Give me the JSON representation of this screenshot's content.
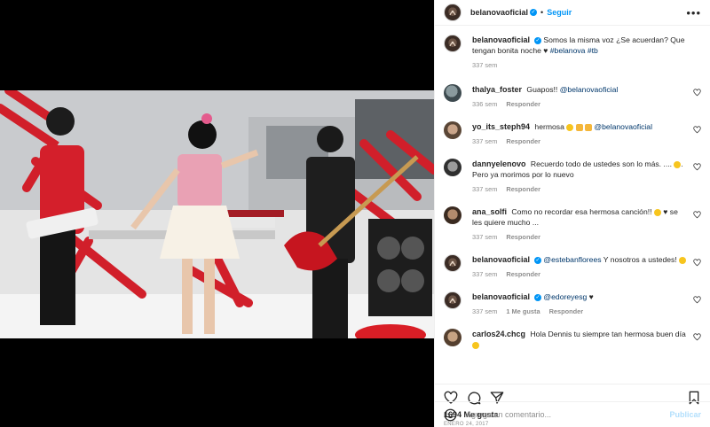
{
  "post": {
    "username": "belanovaoficial",
    "follow_label": "Seguir",
    "dot": "•",
    "caption": {
      "text": "Somos la misma voz ¿Se acuerdan? Que tengan bonita noche ♥",
      "hashtags": "#belanova #tb",
      "time": "337 sem"
    }
  },
  "comments": [
    {
      "username": "thalya_foster",
      "text": "Guapos!! ",
      "mention": "@belanovaoficial",
      "tail": "",
      "time": "336 sem",
      "reply": "Responder",
      "likes": ""
    },
    {
      "username": "yo_its_steph94",
      "text": "hermosa",
      "mention": "@belanovaoficial",
      "tail": "",
      "time": "337 sem",
      "reply": "Responder",
      "likes": ""
    },
    {
      "username": "dannyelenovo",
      "text": "Recuerdo todo de ustedes son lo más. ....",
      "mention": "",
      "tail": ". Pero ya morimos por lo nuevo",
      "time": "337 sem",
      "reply": "Responder",
      "likes": ""
    },
    {
      "username": "ana_solfi",
      "text": "Como no recordar esa hermosa canción!!",
      "mention": "",
      "tail": "se les quiere mucho ...",
      "time": "337 sem",
      "reply": "Responder",
      "likes": ""
    },
    {
      "username": "belanovaoficial",
      "text": "",
      "mention": "@estebanflorees",
      "tail": " Y nosotros a ustedes!",
      "time": "337 sem",
      "reply": "Responder",
      "likes": ""
    },
    {
      "username": "belanovaoficial",
      "text": "",
      "mention": "@edoreyesg",
      "tail": " ♥",
      "time": "337 sem",
      "reply": "Responder",
      "likes": "1 Me gusta"
    },
    {
      "username": "carlos24.chcg",
      "text": "Hola Dennis tu siempre tan hermosa buen día",
      "mention": "",
      "tail": "",
      "time": "",
      "reply": "",
      "likes": ""
    }
  ],
  "actions": {
    "like_count": "1694 Me gusta",
    "date": "ENERO 24, 2017"
  },
  "add_comment": {
    "placeholder": "Agrega un comentario...",
    "publish": "Publicar"
  },
  "colors": {
    "link": "#0095f6",
    "mention": "#00376b",
    "muted": "#8e8e8e"
  }
}
